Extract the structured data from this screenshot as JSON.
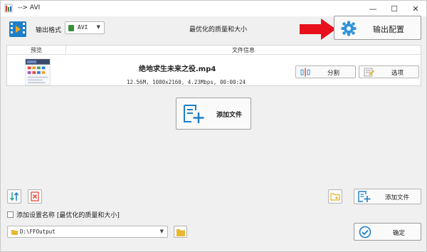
{
  "window": {
    "title": "--> AVI",
    "minimize_glyph": "—",
    "maximize_glyph": "☐",
    "close_glyph": "✕"
  },
  "header": {
    "format_label": "输出格式",
    "format_value": "AVI",
    "preset_label": "最优化的质量和大小",
    "output_config_label": "输出配置"
  },
  "table": {
    "columns": [
      "预览",
      "文件信息"
    ],
    "rows": [
      {
        "name": "绝地求生未来之役.mp4",
        "meta": "12.56M, 1080x2160, 4.23Mbps, 00:00:24",
        "split_label": "分割",
        "options_label": "选项"
      }
    ]
  },
  "add_file_center_label": "添加文件",
  "toolbar": {
    "add_file_label": "添加文件"
  },
  "add_preset_name_label": "添加设置名称 [最优化的质量和大小]",
  "output_path": "D:\\FFOutput",
  "ok_label": "确定",
  "colors": {
    "accent_blue": "#1e7fc8",
    "arrow_red": "#e8101a",
    "folder_yellow": "#e8b830"
  }
}
